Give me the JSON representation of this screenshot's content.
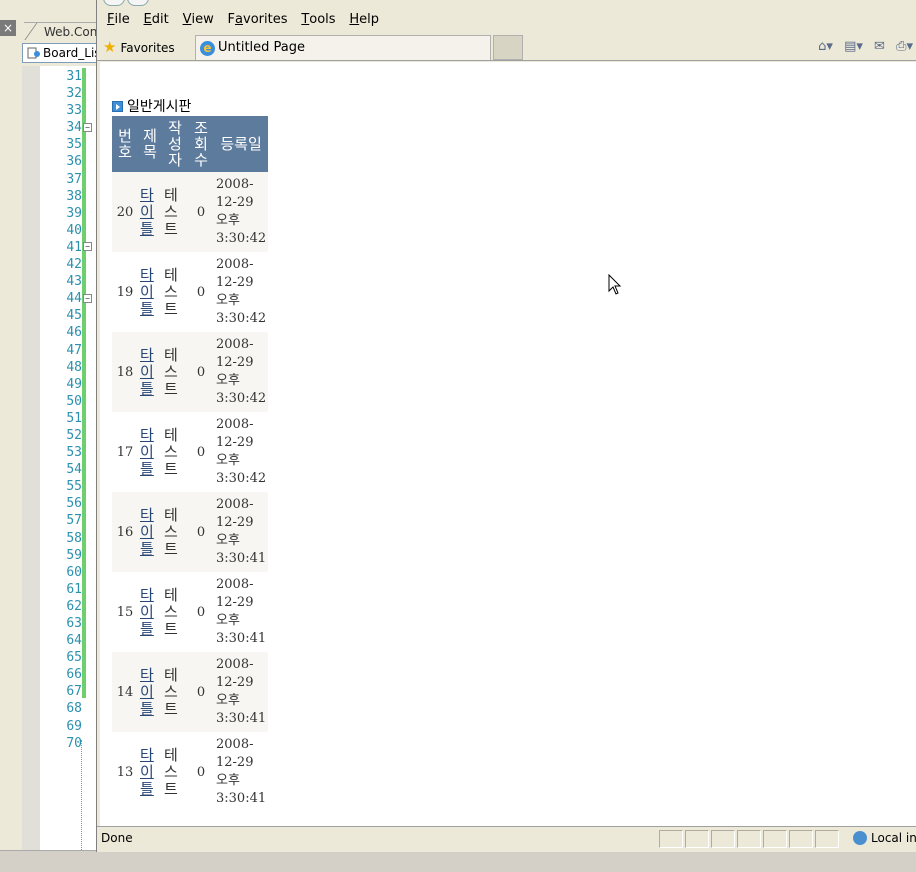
{
  "ide": {
    "close_glyph": "×",
    "tab_web": "Web.Con",
    "file_tab": "Board_Lis",
    "line_numbers": [
      "31",
      "32",
      "33",
      "34",
      "35",
      "36",
      "37",
      "38",
      "39",
      "40",
      "41",
      "42",
      "43",
      "44",
      "45",
      "46",
      "47",
      "48",
      "49",
      "50",
      "51",
      "52",
      "53",
      "54",
      "55",
      "56",
      "57",
      "58",
      "59",
      "60",
      "61",
      "62",
      "63",
      "64",
      "65",
      "66",
      "67",
      "68",
      "69",
      "70"
    ]
  },
  "browser": {
    "menu": [
      {
        "key": "F",
        "rest": "ile"
      },
      {
        "key": "E",
        "rest": "dit"
      },
      {
        "key": "V",
        "rest": "iew"
      },
      {
        "key": "",
        "pre": "F",
        "mid": "a",
        "rest": "vorites"
      },
      {
        "key": "T",
        "rest": "ools"
      },
      {
        "key": "H",
        "rest": "elp"
      }
    ],
    "favorites_label": "Favorites",
    "tab_title": "Untitled Page",
    "status_text": "Done",
    "zone_text": "Local in"
  },
  "page": {
    "board_title": "일반게시판",
    "columns": [
      "번호",
      "제목",
      "작성자",
      "조회수",
      "등록일"
    ],
    "rows": [
      {
        "no": "20",
        "subject": "타이틀",
        "writer": "테스트",
        "hits": "0",
        "date": "2008-12-29",
        "ampm": "오후",
        "time": "3:30:42"
      },
      {
        "no": "19",
        "subject": "타이틀",
        "writer": "테스트",
        "hits": "0",
        "date": "2008-12-29",
        "ampm": "오후",
        "time": "3:30:42"
      },
      {
        "no": "18",
        "subject": "타이틀",
        "writer": "테스트",
        "hits": "0",
        "date": "2008-12-29",
        "ampm": "오후",
        "time": "3:30:42"
      },
      {
        "no": "17",
        "subject": "타이틀",
        "writer": "테스트",
        "hits": "0",
        "date": "2008-12-29",
        "ampm": "오후",
        "time": "3:30:42"
      },
      {
        "no": "16",
        "subject": "타이틀",
        "writer": "테스트",
        "hits": "0",
        "date": "2008-12-29",
        "ampm": "오후",
        "time": "3:30:41"
      },
      {
        "no": "15",
        "subject": "타이틀",
        "writer": "테스트",
        "hits": "0",
        "date": "2008-12-29",
        "ampm": "오후",
        "time": "3:30:41"
      },
      {
        "no": "14",
        "subject": "타이틀",
        "writer": "테스트",
        "hits": "0",
        "date": "2008-12-29",
        "ampm": "오후",
        "time": "3:30:41"
      },
      {
        "no": "13",
        "subject": "타이틀",
        "writer": "테스트",
        "hits": "0",
        "date": "2008-12-29",
        "ampm": "오후",
        "time": "3:30:41"
      }
    ]
  },
  "colors": {
    "header_bg": "#5d7b9d",
    "link": "#284775",
    "alt_row": "#f7f6f3",
    "line_number": "#2b91af"
  }
}
